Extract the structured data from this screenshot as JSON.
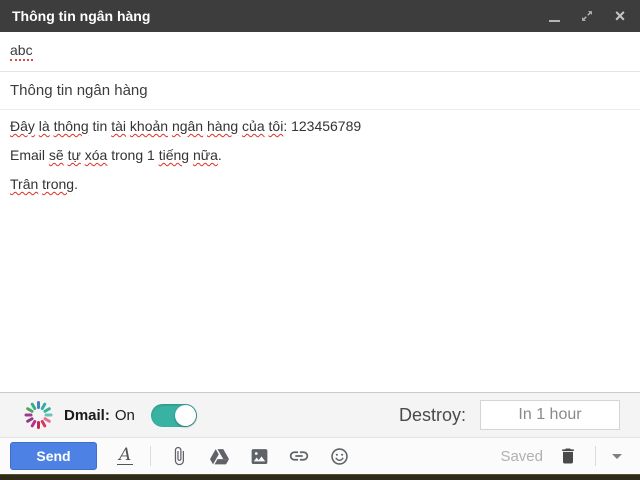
{
  "window": {
    "title": "Thông tin ngân hàng",
    "icons": {
      "minimize": "minimize-icon",
      "expand": "expand-icon",
      "close_glyph": "×"
    }
  },
  "compose": {
    "to": {
      "value": "abc"
    },
    "subject": {
      "value": "Thông tin ngân hàng"
    },
    "body": {
      "lines": [
        {
          "segments": [
            {
              "t": "Đây",
              "m": true
            },
            {
              "t": " "
            },
            {
              "t": "là",
              "m": true
            },
            {
              "t": " "
            },
            {
              "t": "thông",
              "m": true
            },
            {
              "t": " tin "
            },
            {
              "t": "tài",
              "m": true
            },
            {
              "t": " "
            },
            {
              "t": "khoản",
              "m": true
            },
            {
              "t": " "
            },
            {
              "t": "ngân",
              "m": true
            },
            {
              "t": " "
            },
            {
              "t": "hàng",
              "m": true
            },
            {
              "t": " "
            },
            {
              "t": "của",
              "m": true
            },
            {
              "t": " "
            },
            {
              "t": "tôi",
              "m": true
            },
            {
              "t": ": 123456789"
            }
          ]
        },
        {
          "segments": [
            {
              "t": "Email "
            },
            {
              "t": "sẽ",
              "m": true
            },
            {
              "t": " "
            },
            {
              "t": "tự",
              "m": true
            },
            {
              "t": " "
            },
            {
              "t": "xóa",
              "m": true
            },
            {
              "t": " trong 1 "
            },
            {
              "t": "tiếng",
              "m": true
            },
            {
              "t": " "
            },
            {
              "t": "nữa",
              "m": true
            },
            {
              "t": "."
            }
          ]
        },
        {
          "segments": [
            {
              "t": "Trân",
              "m": true
            },
            {
              "t": " "
            },
            {
              "t": "trong",
              "m": true
            },
            {
              "t": "."
            }
          ]
        }
      ]
    }
  },
  "dmail": {
    "label": "Dmail:",
    "status": "On",
    "toggle_on": true,
    "destroy_label": "Destroy:",
    "destroy_value": "In 1 hour",
    "spinner_colors": [
      "#4a7fc1",
      "#35b0a0",
      "#35b0a0",
      "#6cc2b5",
      "#e4718e",
      "#d63964",
      "#c2265a",
      "#b5338a",
      "#93358b",
      "#a03a8c",
      "#4aa75f",
      "#39ad8a"
    ]
  },
  "toolbar": {
    "send_label": "Send",
    "saved_label": "Saved",
    "icons": [
      "formatting-icon",
      "attach-file-icon",
      "drive-icon",
      "insert-photo-icon",
      "insert-link-icon",
      "emoji-icon",
      "trash-icon",
      "more-options-caret-icon"
    ]
  },
  "colors": {
    "titlebar": "#3d3d3d",
    "send_blue": "#4d82e4",
    "toggle_teal": "#38b2a3",
    "squiggle_red": "#d93025",
    "icon_gray": "#5f6368"
  }
}
